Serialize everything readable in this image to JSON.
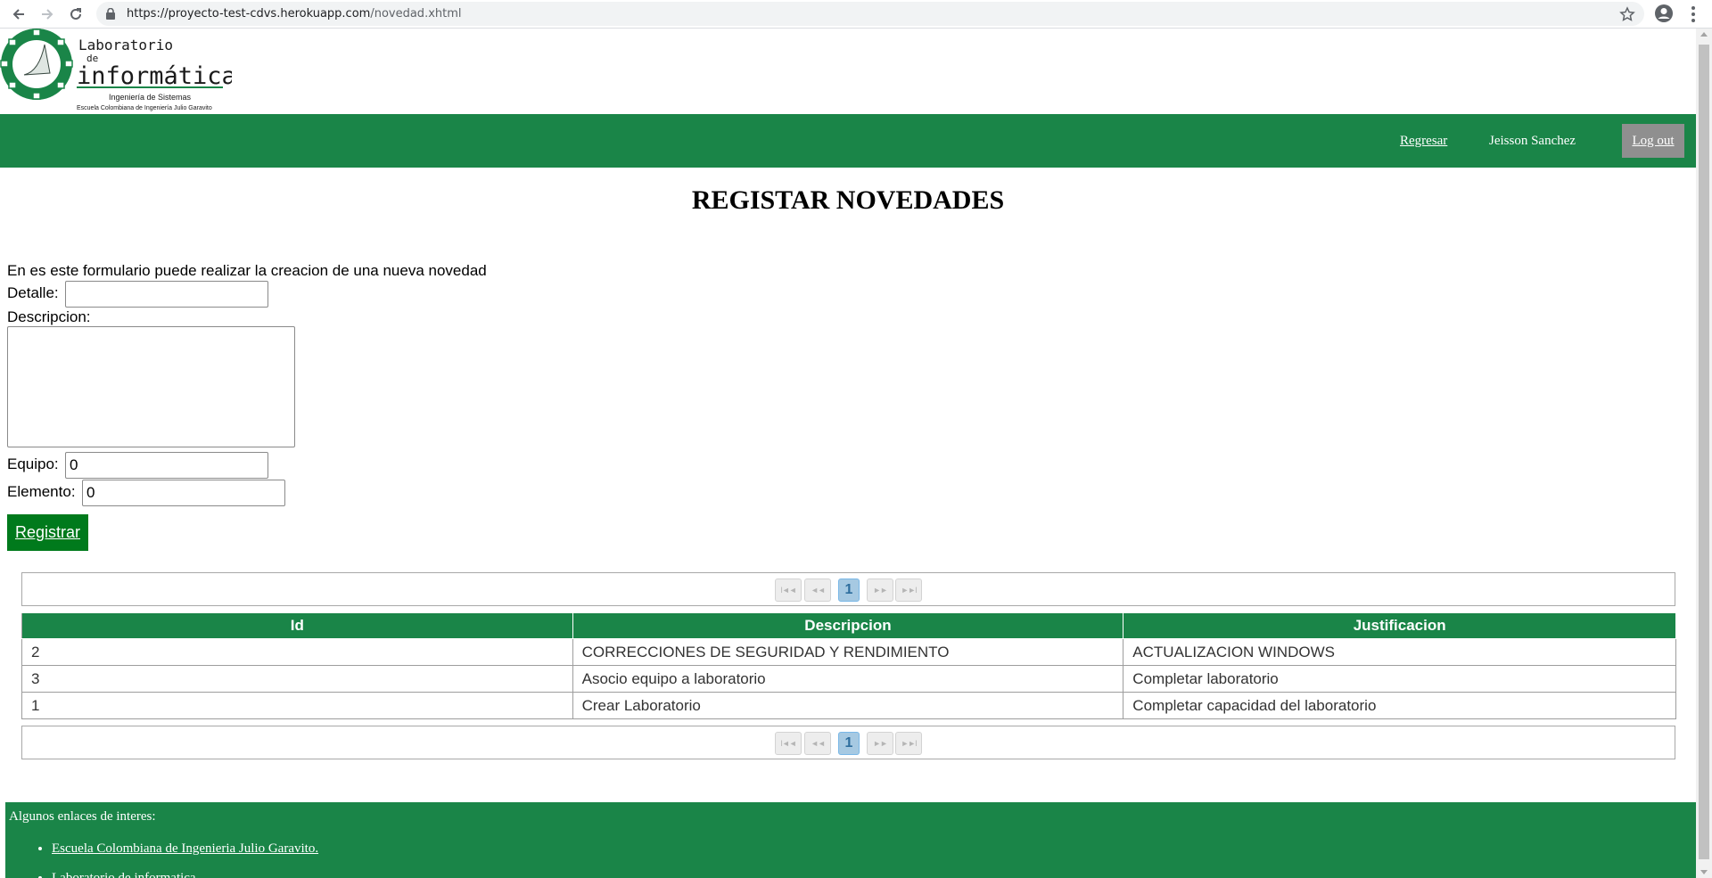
{
  "browser": {
    "url_host": "https://proyecto-test-cdvs.herokuapp.com",
    "url_path": "/novedad.xhtml",
    "icons": [
      "back-icon",
      "forward-icon",
      "reload-icon",
      "lock-icon",
      "star-icon",
      "account-icon",
      "kebab-menu-icon"
    ]
  },
  "logo": {
    "line1": "Laboratorio",
    "line2": "de",
    "line3": "informática",
    "line4": "Ingeniería de Sistemas",
    "line5": "Escuela Colombiana de Ingeniería Julio Garavito"
  },
  "header": {
    "back_link": "Regresar",
    "user_name": "Jeisson Sanchez",
    "logout": "Log out"
  },
  "form": {
    "title": "REGISTAR NOVEDADES",
    "intro": "En es este formulario puede realizar la creacion de una nueva novedad",
    "detalle_label": "Detalle:",
    "detalle_value": "",
    "descripcion_label": "Descripcion:",
    "equipo_label": "Equipo:",
    "equipo_value": "0",
    "elemento_label": "Elemento:",
    "elemento_value": "0",
    "submit": "Registrar"
  },
  "paginator": {
    "current_page": "1",
    "first": "I◄◄",
    "prev": "◄◄",
    "next": "►►",
    "last": "►►I"
  },
  "table": {
    "columns": [
      "Id",
      "Descripcion",
      "Justificacion"
    ],
    "rows": [
      [
        "2",
        "CORRECCIONES DE SEGURIDAD Y RENDIMIENTO",
        "ACTUALIZACION WINDOWS"
      ],
      [
        "3",
        "Asocio equipo a laboratorio",
        "Completar laboratorio"
      ],
      [
        "1",
        "Crear Laboratorio",
        "Completar capacidad del laboratorio"
      ]
    ]
  },
  "footer": {
    "title": "Algunos enlaces de interes:",
    "links": [
      "Escuela Colombiana de Ingenieria Julio Garavito.",
      "Laboratorio de informatica"
    ]
  },
  "colors": {
    "brand_green": "#1a8548",
    "button_green": "#007a1c",
    "logout_gray": "#8f8f8f"
  }
}
